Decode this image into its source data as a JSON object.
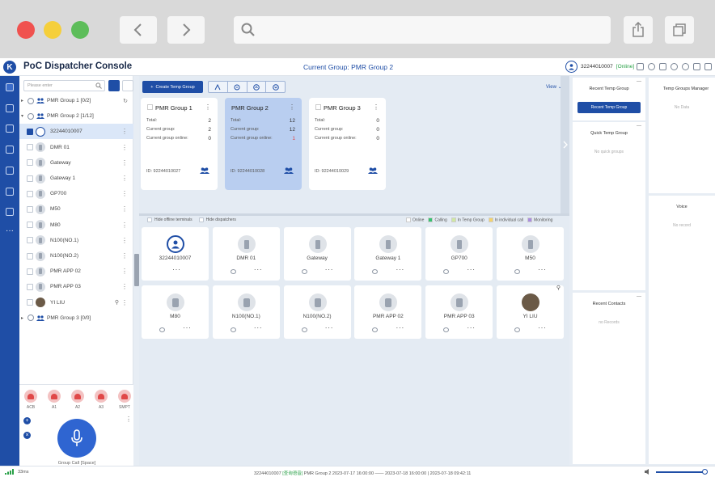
{
  "app": {
    "title": "PoC Dispatcher Console",
    "current_group_label": "Current Group:",
    "current_group_value": "PMR Group 2",
    "user_id": "32244010007",
    "user_status": "[Online]",
    "logo_glyph": "K"
  },
  "tree": {
    "search_placeholder": "Please enter",
    "rows": [
      {
        "label": "PMR Group 1 [0/2]",
        "kind": "group"
      },
      {
        "label": "PMR Group 2 [1/12]",
        "kind": "group"
      },
      {
        "label": "32244010007",
        "kind": "dispatcher"
      },
      {
        "label": "DMR 01",
        "kind": "device"
      },
      {
        "label": "Gateway",
        "kind": "device"
      },
      {
        "label": "Gateway 1",
        "kind": "device"
      },
      {
        "label": "GP700",
        "kind": "device"
      },
      {
        "label": "M50",
        "kind": "device"
      },
      {
        "label": "M80",
        "kind": "device"
      },
      {
        "label": "N100(NO.1)",
        "kind": "device"
      },
      {
        "label": "N100(NO.2)",
        "kind": "device"
      },
      {
        "label": "PMR APP 02",
        "kind": "device"
      },
      {
        "label": "PMR APP 03",
        "kind": "device"
      },
      {
        "label": "YI LIU",
        "kind": "photo"
      },
      {
        "label": "PMR Group 3 [0/0]",
        "kind": "group"
      }
    ],
    "quick_calls": [
      "ACB",
      "A1",
      "A2",
      "A3",
      "SMPT"
    ],
    "ptt_label": "Group Call [Space]"
  },
  "toolbar": {
    "create_temp_group": "Create Temp Group",
    "view": "View"
  },
  "groups": [
    {
      "name": "PMR Group 1",
      "total": "2",
      "current": "2",
      "online": "0",
      "id": "ID: 92244010027",
      "active": false
    },
    {
      "name": "PMR Group 2",
      "total": "12",
      "current": "12",
      "online": "1",
      "id": "ID: 92244010028",
      "active": true
    },
    {
      "name": "PMR Group 3",
      "total": "0",
      "current": "0",
      "online": "0",
      "id": "ID: 92244010029",
      "active": false
    }
  ],
  "group_labels": {
    "total": "Total:",
    "current": "Current group:",
    "online": "Current group online:"
  },
  "filters": {
    "hide_offline": "Hide offline terminals",
    "hide_dispatchers": "Hide dispatchers"
  },
  "legend": [
    {
      "label": "Online",
      "color": "#ffffff"
    },
    {
      "label": "Calling",
      "color": "#38c172"
    },
    {
      "label": "In Temp Group",
      "color": "#cfe8a3"
    },
    {
      "label": "In individual call",
      "color": "#f5d36b"
    },
    {
      "label": "Monitoring",
      "color": "#a98de0"
    }
  ],
  "terminals": [
    {
      "name": "32244010007",
      "kind": "dispatcher"
    },
    {
      "name": "DMR 01",
      "kind": "radio"
    },
    {
      "name": "Gateway",
      "kind": "radio"
    },
    {
      "name": "Gateway 1",
      "kind": "radio"
    },
    {
      "name": "GP700",
      "kind": "radio"
    },
    {
      "name": "M50",
      "kind": "radio"
    },
    {
      "name": "M80",
      "kind": "phone"
    },
    {
      "name": "N100(NO.1)",
      "kind": "phone"
    },
    {
      "name": "N100(NO.2)",
      "kind": "phone"
    },
    {
      "name": "PMR APP 02",
      "kind": "phone"
    },
    {
      "name": "PMR APP 03",
      "kind": "phone"
    },
    {
      "name": "YI LIU",
      "kind": "photo"
    }
  ],
  "right": {
    "recent_temp_title": "Recent Temp Group",
    "recent_temp_button": "Recent Temp Group",
    "quick_temp_title": "Quick Temp Group",
    "quick_temp_empty": "No quick groups",
    "recent_contacts_title": "Recent Contacts",
    "recent_contacts_empty": "no Records",
    "temp_mgr_title": "Temp Groups Manager",
    "temp_mgr_empty": "No Data",
    "voice_title": "Voice",
    "voice_empty": "No record"
  },
  "status": {
    "latency": "33ms",
    "user": "32244010007",
    "state": "[查询语音]",
    "message": "PMR Group 2 2023-07-17 16:00:00 —— 2023-07-18 16:00:00 | 2023-07-18 09:42:11"
  }
}
